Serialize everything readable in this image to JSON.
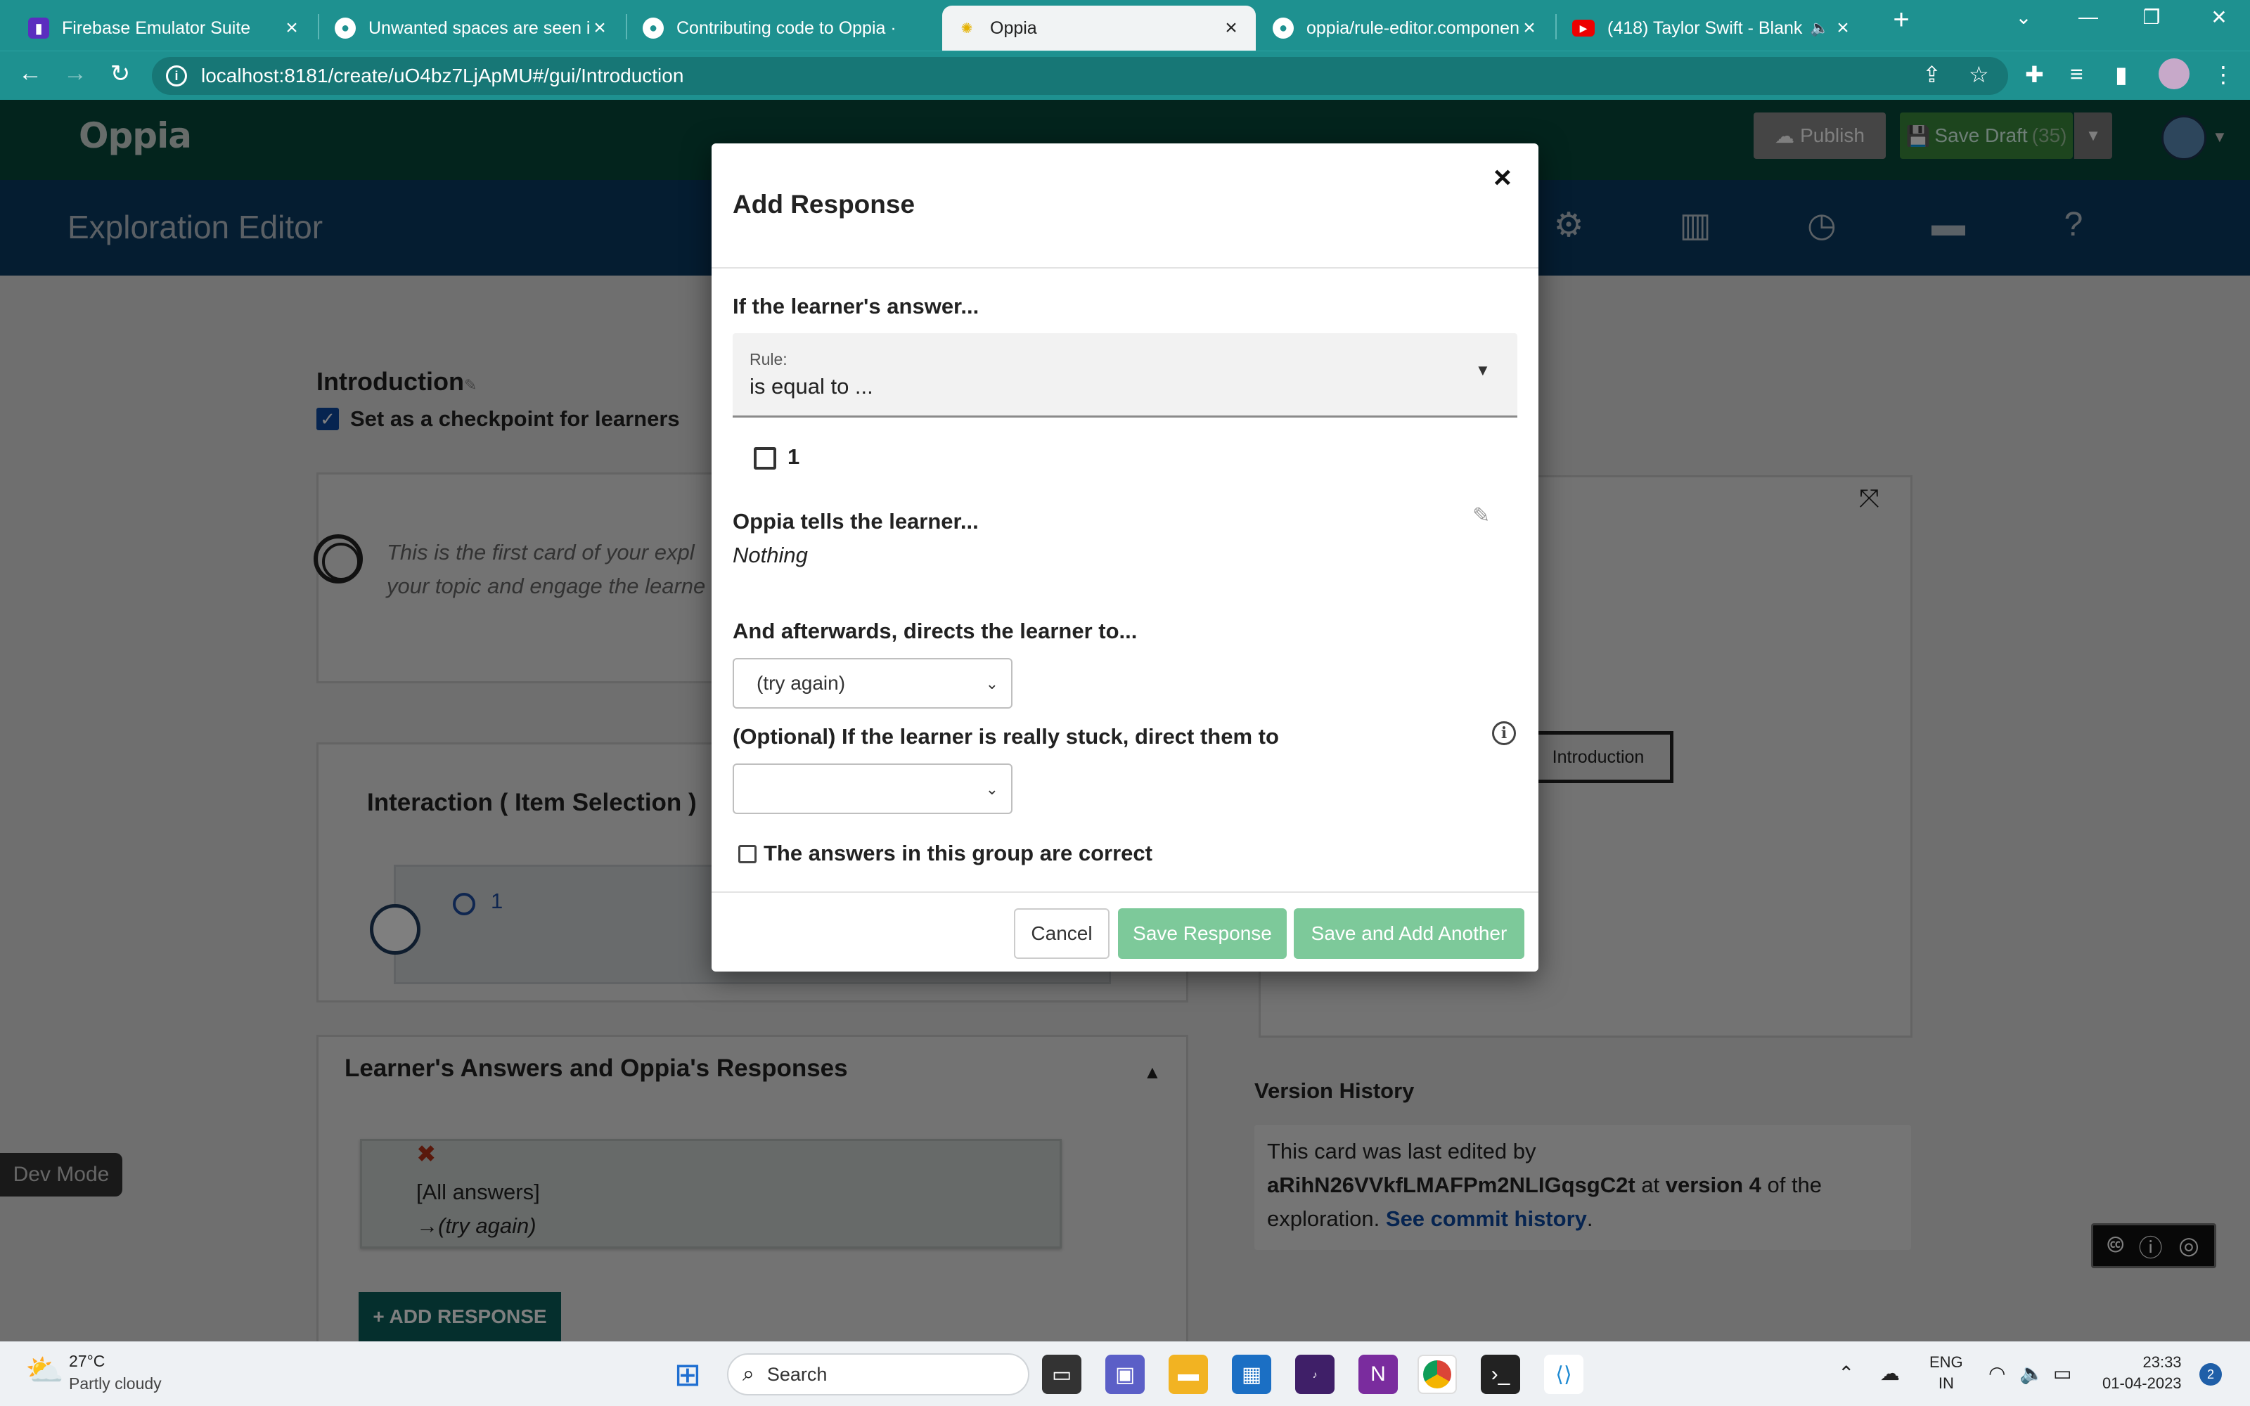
{
  "browser": {
    "tabs": [
      {
        "title": "Firebase Emulator Suite",
        "icon": "firebase-icon"
      },
      {
        "title": "Unwanted spaces are seen in",
        "icon": "github-icon"
      },
      {
        "title": "Contributing code to Oppia ·",
        "icon": "github-icon"
      },
      {
        "title": "Oppia",
        "icon": "oppia-icon",
        "active": true
      },
      {
        "title": "oppia/rule-editor.component",
        "icon": "github-icon"
      },
      {
        "title": "(418) Taylor Swift - Blank",
        "icon": "youtube-icon"
      }
    ],
    "url": "localhost:8181/create/uO4bz7LjApMU#/gui/Introduction"
  },
  "app": {
    "logo": "Oppia",
    "publish_label": "Publish",
    "save_draft_label": "Save Draft",
    "save_draft_count": "(35)",
    "editor_title": "Exploration Editor",
    "nav_icons": [
      "settings-icon",
      "stats-icon",
      "history-icon",
      "feedback-icon",
      "help-icon"
    ]
  },
  "state": {
    "name": "Introduction",
    "checkpoint_label": "Set as a checkpoint for learners",
    "content_text": "This is the first card of your expl your topic and engage the learne",
    "interaction_title": "Interaction ( Item Selection )",
    "preview_choice": "1",
    "answers_title": "Learner's Answers and Oppia's Responses",
    "answer_group_all": "[All answers]",
    "answer_group_dest": "→(try again)",
    "add_response_label": "+ ADD RESPONSE",
    "dev_mode_label": "Dev Mode"
  },
  "graph": {
    "node_label": "Introduction"
  },
  "version_history": {
    "title": "Version History",
    "line1": "This card was last edited by",
    "user": "aRihN26VVkfLMAFPm2NLIGqsgC2t",
    "at": " at ",
    "version": "version 4",
    "of_the": " of the",
    "line3": "exploration. ",
    "link": "See commit history",
    "period": "."
  },
  "modal": {
    "title": "Add Response",
    "close": "×",
    "answer_heading": "If the learner's answer...",
    "rule_small_label": "Rule:",
    "rule_value": "is equal to ...",
    "choice_label": "1",
    "feedback_heading": "Oppia tells the learner...",
    "feedback_value": "Nothing",
    "dest_heading": "And afterwards, directs the learner to...",
    "dest_value": "(try again)",
    "stuck_heading": "(Optional) If the learner is really stuck, direct them to",
    "stuck_value": "",
    "correct_label": "The answers in this group are correct",
    "cancel_label": "Cancel",
    "save_label": "Save Response",
    "save_another_label": "Save and Add Another"
  },
  "taskbar": {
    "weather_temp": "27°C",
    "weather_desc": "Partly cloudy",
    "search_placeholder": "Search",
    "lang_line1": "ENG",
    "lang_line2": "IN",
    "time": "23:33",
    "date": "01-04-2023",
    "notifications": "2"
  },
  "colors": {
    "browser_teal": "#1e9190",
    "oppia_header": "#07493a",
    "editor_bar": "#0a3b62",
    "save_button": "#7dc99a"
  }
}
